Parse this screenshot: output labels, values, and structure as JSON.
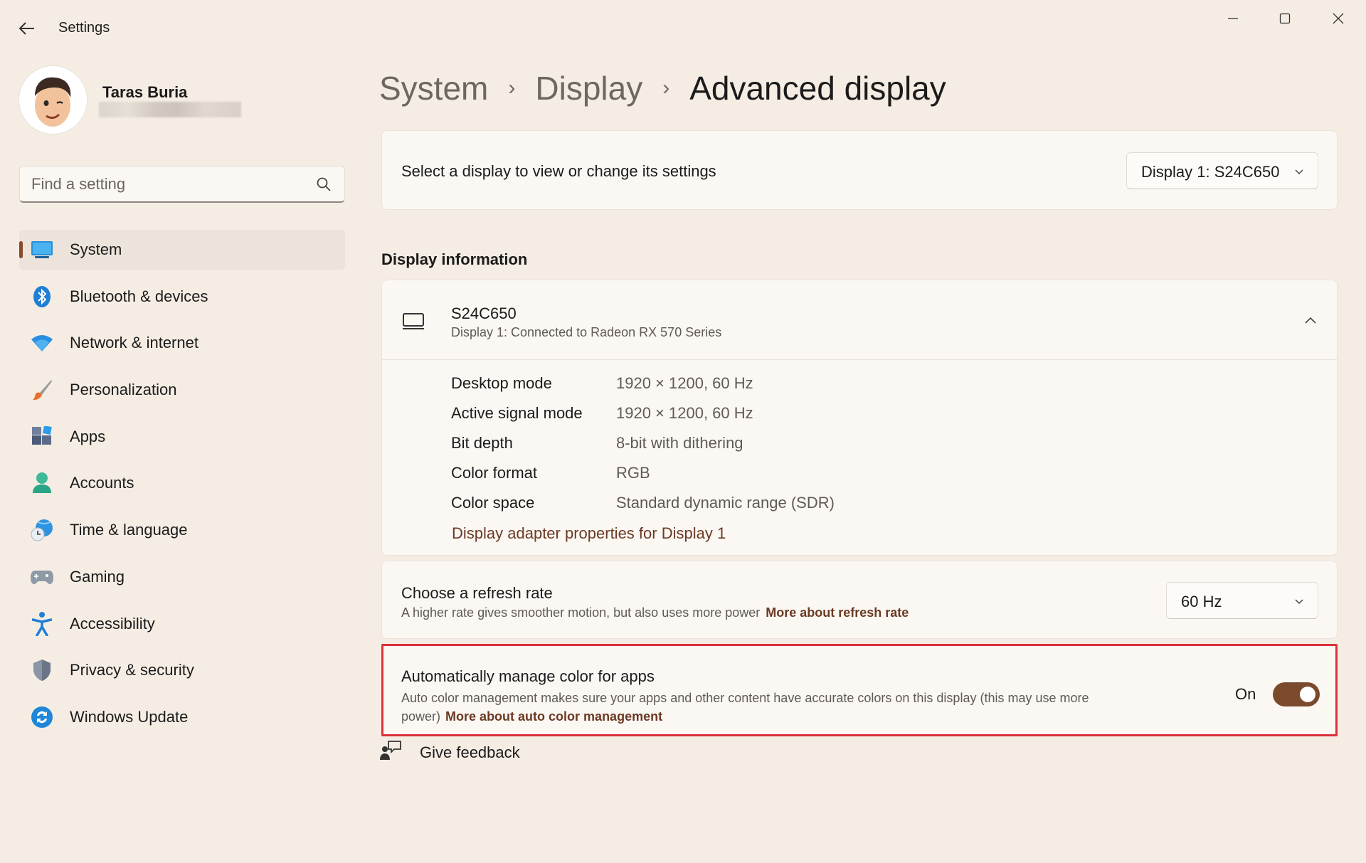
{
  "window": {
    "title": "Settings"
  },
  "profile": {
    "name": "Taras Buria"
  },
  "search": {
    "placeholder": "Find a setting"
  },
  "sidebar": {
    "items": [
      {
        "label": "System",
        "icon": "system-icon",
        "active": true
      },
      {
        "label": "Bluetooth & devices",
        "icon": "bluetooth-icon"
      },
      {
        "label": "Network & internet",
        "icon": "wifi-icon"
      },
      {
        "label": "Personalization",
        "icon": "paintbrush-icon"
      },
      {
        "label": "Apps",
        "icon": "apps-icon"
      },
      {
        "label": "Accounts",
        "icon": "person-icon"
      },
      {
        "label": "Time & language",
        "icon": "globe-clock-icon"
      },
      {
        "label": "Gaming",
        "icon": "gamepad-icon"
      },
      {
        "label": "Accessibility",
        "icon": "accessibility-icon"
      },
      {
        "label": "Privacy & security",
        "icon": "shield-icon"
      },
      {
        "label": "Windows Update",
        "icon": "update-icon"
      }
    ]
  },
  "breadcrumb": {
    "items": [
      "System",
      "Display"
    ],
    "current": "Advanced display",
    "separator": "›"
  },
  "display_select": {
    "label": "Select a display to view or change its settings",
    "selected": "Display 1: S24C650"
  },
  "display_info": {
    "section_title": "Display information",
    "name": "S24C650",
    "subtitle": "Display 1: Connected to Radeon RX 570 Series",
    "rows": [
      {
        "key": "Desktop mode",
        "value": "1920 × 1200, 60 Hz"
      },
      {
        "key": "Active signal mode",
        "value": "1920 × 1200, 60 Hz"
      },
      {
        "key": "Bit depth",
        "value": "8-bit with dithering"
      },
      {
        "key": "Color format",
        "value": "RGB"
      },
      {
        "key": "Color space",
        "value": "Standard dynamic range (SDR)"
      }
    ],
    "adapter_link": "Display adapter properties for Display 1"
  },
  "refresh_rate": {
    "title": "Choose a refresh rate",
    "description": "A higher rate gives smoother motion, but also uses more power",
    "link": "More about refresh rate",
    "selected": "60 Hz"
  },
  "auto_color": {
    "title": "Automatically manage color for apps",
    "description": "Auto color management makes sure your apps and other content have accurate colors on this display (this may use more power)",
    "link": "More about auto color management",
    "state_label": "On",
    "enabled": true
  },
  "feedback": {
    "label": "Give feedback"
  },
  "colors": {
    "accent": "#7b4a2d",
    "highlight_border": "#d9313a",
    "background": "#f5ede3"
  }
}
